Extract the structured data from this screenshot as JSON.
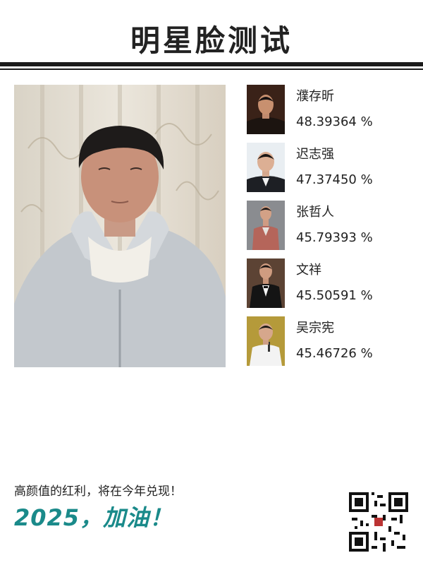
{
  "header": {
    "title": "明星脸测试"
  },
  "results": [
    {
      "name": "濮存昕",
      "score": "48.39364 %"
    },
    {
      "name": "迟志强",
      "score": "47.37450 %"
    },
    {
      "name": "张哲人",
      "score": "45.79393 %"
    },
    {
      "name": "文祥",
      "score": "45.50591 %"
    },
    {
      "name": "吴宗宪",
      "score": "45.46726 %"
    }
  ],
  "footer": {
    "slogan": "高颜值的红利，将在今年兑现！",
    "cheer": "2025，加油！"
  },
  "colors": {
    "accent": "#1a8a8a",
    "rule": "#1a1a1a"
  }
}
